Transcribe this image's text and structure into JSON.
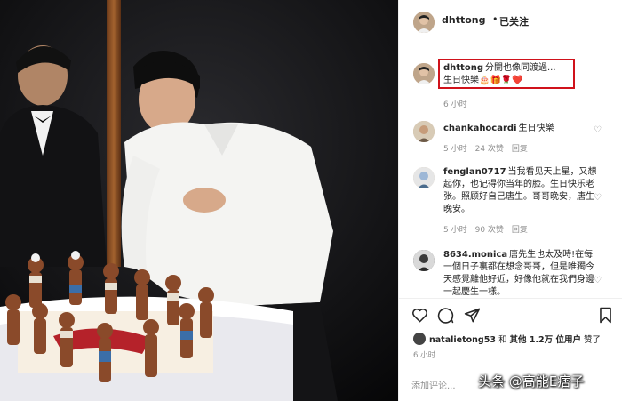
{
  "post": {
    "username": "dhttong",
    "separator": "•",
    "follow_status": "已关注",
    "caption": {
      "user": "dhttong",
      "line1": "分開也像同渡過...",
      "line2": "生日快樂🎂🎁🌹❤️",
      "time": "6 小时"
    },
    "highlight_color": "#d0121b"
  },
  "comments": [
    {
      "user": "chankahocardi",
      "text": "生日快樂",
      "time": "5 小时",
      "likes": "24 次赞",
      "reply": "回复"
    },
    {
      "user": "fenglan0717",
      "text": "当我看见天上星，又想起你，也记得你当年的脸。生日快乐老张。照顾好自己唐生。哥哥晚安，唐生晚安。",
      "time": "5 小时",
      "likes": "90 次赞",
      "reply": "回复"
    },
    {
      "user": "8634.monica",
      "text": "唐先生也太及時!在每一個日子裏都在想念哥哥，但是唯獨今天感覺離他好近，好像他就在我們身邊一起慶生一樣。",
      "time": "",
      "likes": "",
      "reply": ""
    }
  ],
  "actions": {
    "like_icon": "heart-icon",
    "comment_icon": "comment-icon",
    "share_icon": "share-icon",
    "save_icon": "bookmark-icon"
  },
  "likes": {
    "user": "natalietong53",
    "connector": "和",
    "others_label": "其他 1.2万 位用户",
    "suffix": "赞了"
  },
  "posted_time": "6 小时",
  "add_comment_placeholder": "添加评论...",
  "watermark": "头条 @高能E痞子"
}
